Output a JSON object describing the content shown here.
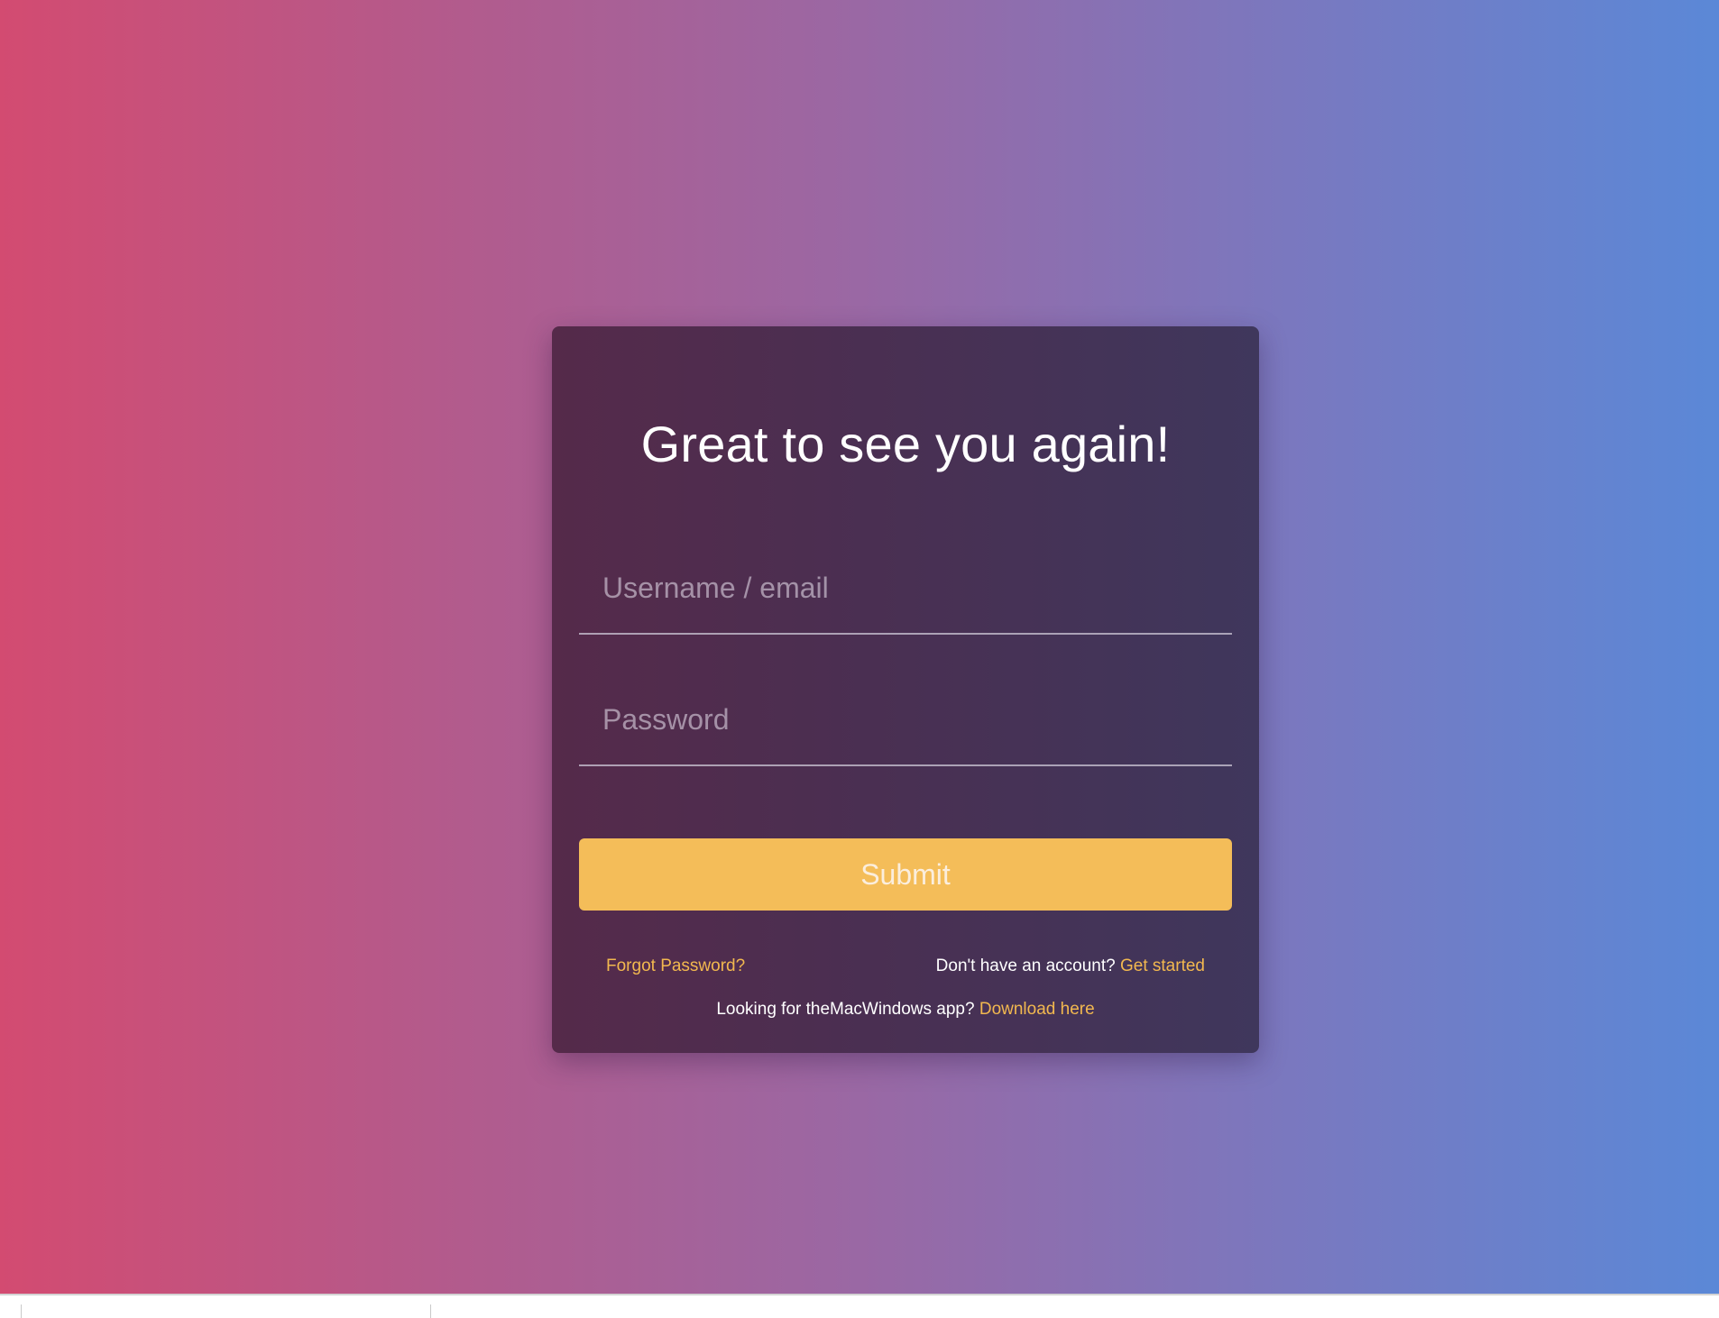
{
  "login": {
    "title": "Great to see you again!",
    "username_placeholder": "Username / email",
    "username_value": "",
    "password_placeholder": "Password",
    "password_value": "",
    "submit_label": "Submit",
    "forgot_password": "Forgot Password?",
    "no_account_text": "Don't have an account?",
    "get_started": "Get started",
    "app_text": "Looking for theMacWindows app?",
    "download_link": "Download here"
  },
  "colors": {
    "accent": "#f4bd59",
    "card_background": "#4a2f52",
    "gradient_start": "#d34b71",
    "gradient_end": "#5b88d7"
  }
}
